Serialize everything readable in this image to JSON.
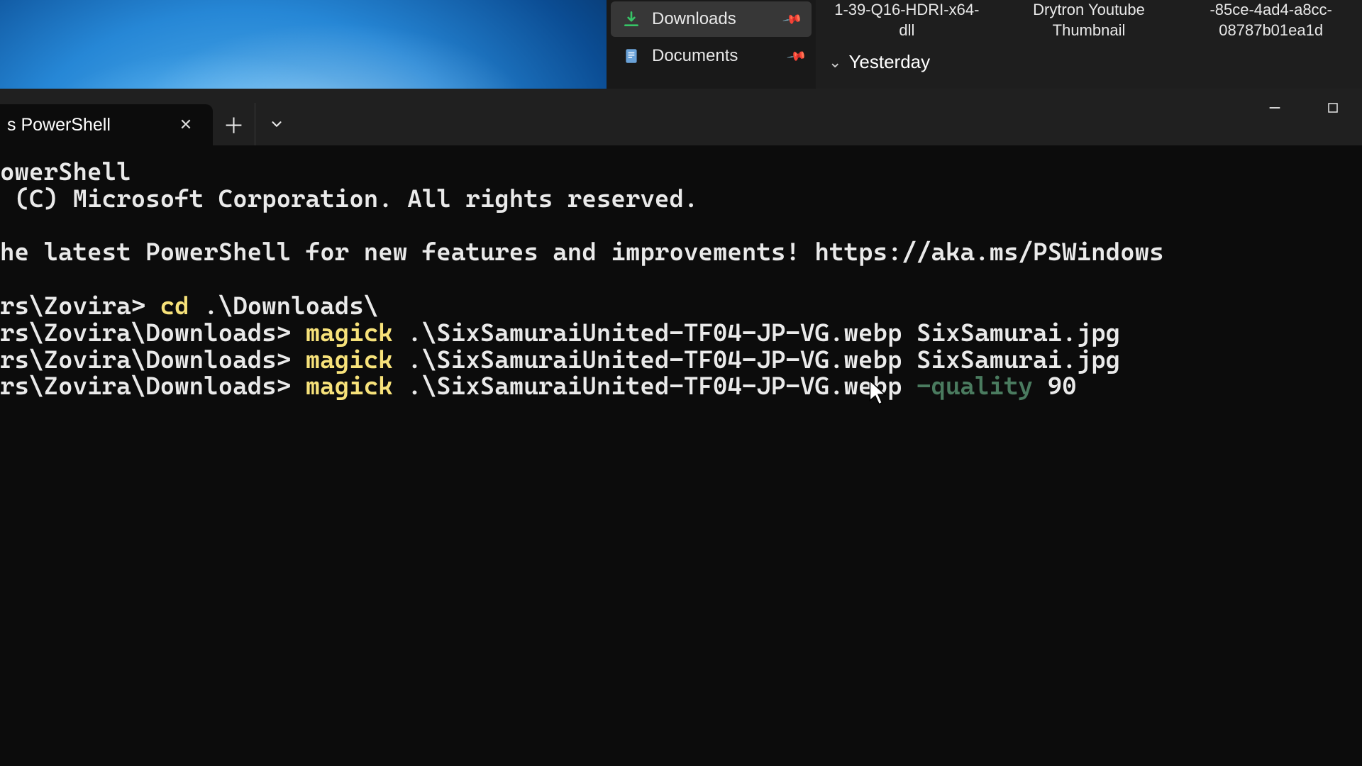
{
  "explorer": {
    "nav": {
      "downloads": "Downloads",
      "documents": "Documents"
    },
    "files": [
      "1-39-Q16-HDRI-x64-dll",
      "Drytron Youtube Thumbnail",
      "-85ce-4ad4-a8cc-08787b01ea1d"
    ],
    "group": "Yesterday"
  },
  "terminal": {
    "tab_title": "s PowerShell",
    "header_line1": "owerShell",
    "header_line2": " (C) Microsoft Corporation. All rights reserved.",
    "tip_prefix": "he latest PowerShell for new features and improvements! ",
    "tip_url": "https://aka.ms/PSWindows",
    "lines": [
      {
        "prompt": "rs\\Zovira> ",
        "cmd": "cd",
        "args": " .\\Downloads\\"
      },
      {
        "prompt": "rs\\Zovira\\Downloads> ",
        "cmd": "magick",
        "args": " .\\SixSamuraiUnited-TF04-JP-VG.webp SixSamurai.jpg"
      },
      {
        "prompt": "rs\\Zovira\\Downloads> ",
        "cmd": "magick",
        "args": " .\\SixSamuraiUnited-TF04-JP-VG.webp SixSamurai.jpg"
      },
      {
        "prompt": "rs\\Zovira\\Downloads> ",
        "cmd": "magick",
        "args_pre": " .\\SixSamuraiUnited-TF04-JP-VG.webp ",
        "ghost": "-quality",
        "args_post": " 90"
      }
    ]
  }
}
